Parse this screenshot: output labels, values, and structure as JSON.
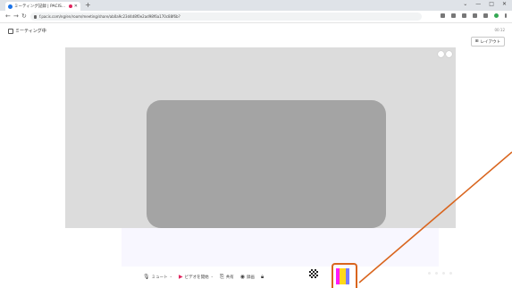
{
  "browser": {
    "tab_title": "ミーティング記録 | PACIS...",
    "new_tab_symbol": "+",
    "url": "f.pacis.com/ng/en/room/meeting/share/ab0a9c23d4d8f0e2ad98f6a170c88f6b?",
    "window_controls": [
      "⌄",
      "—",
      "□",
      "✕"
    ]
  },
  "app": {
    "title": "ミーティング中",
    "timer": "00:12",
    "layout_button": "レイアウト"
  },
  "toolbar": {
    "mute": "ミュート",
    "video": "ビデオを開始",
    "share": "共有",
    "record": "録画"
  },
  "colors": {
    "accent": "#d9651e",
    "share_bg": "#dcdcdc",
    "tile": "#a4a4a4"
  }
}
